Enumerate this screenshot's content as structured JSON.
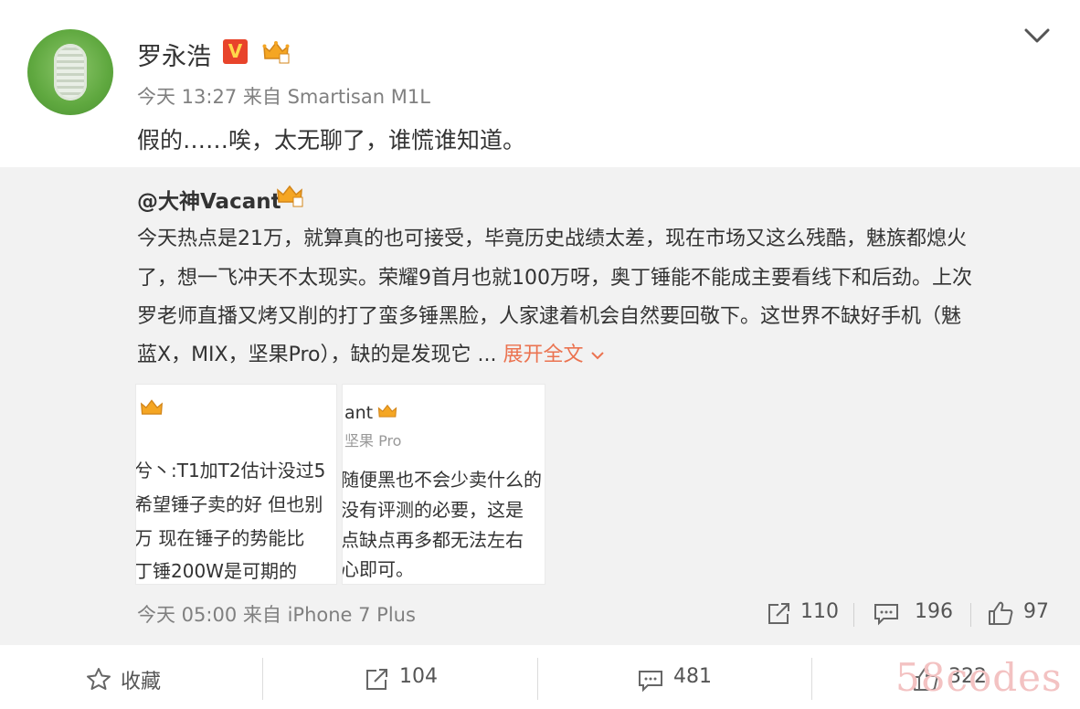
{
  "post": {
    "author": "罗永浩",
    "verified_badge": "V",
    "time": "今天 13:27",
    "source_prefix": "来自",
    "source": "Smartisan M1L",
    "text": "假的……唉，太无聊了，谁慌谁知道。"
  },
  "repost": {
    "handle": "@大神Vacant",
    "lines": [
      "今天热点是21万，就算真的也可接受，毕竟历史战绩太差，现在市场又这么残酷，魅族都熄火",
      "了，想一飞冲天不太现实。荣耀9首月也就100万呀，奥丁锤能不能成主要看线下和后劲。上次",
      "罗老师直播又烤又削的打了蛮多锤黑脸，人家逮着机会自然要回敬下。这世界不缺好手机（魅",
      "蓝X，MIX，坚果Pro），缺的是发现它 ..."
    ],
    "expand_label": "展开全文",
    "thumbs": [
      {
        "lines": [
          "兮丶:T1加T2估计没过5",
          "希望锤子卖的好 但也别",
          "万 现在锤子的势能比",
          "丁锤200W是可期的"
        ]
      },
      {
        "header": "ant",
        "sub": "坚果 Pro",
        "lines": [
          "随便黑也不会少卖什么的",
          "没有评测的必要，这是",
          "点缺点再多都无法左右",
          "心即可。"
        ]
      }
    ],
    "time": "今天 05:00",
    "source_prefix": "来自",
    "source": "iPhone 7 Plus",
    "reposts": "110",
    "comments": "196",
    "likes": "97"
  },
  "footer": {
    "favorite_label": "收藏",
    "reposts": "104",
    "comments": "481",
    "likes": "322"
  },
  "watermark": "58codes",
  "colors": {
    "accent_orange": "#eb7350",
    "badge_red": "#e8442b",
    "badge_yellow": "#ffd84a",
    "quote_bg": "#f2f2f2",
    "meta_gray": "#808080"
  },
  "icons": [
    "chevron-down-icon",
    "verified-v-icon",
    "crown-icon",
    "repost-icon",
    "comment-icon",
    "like-icon",
    "star-icon"
  ]
}
